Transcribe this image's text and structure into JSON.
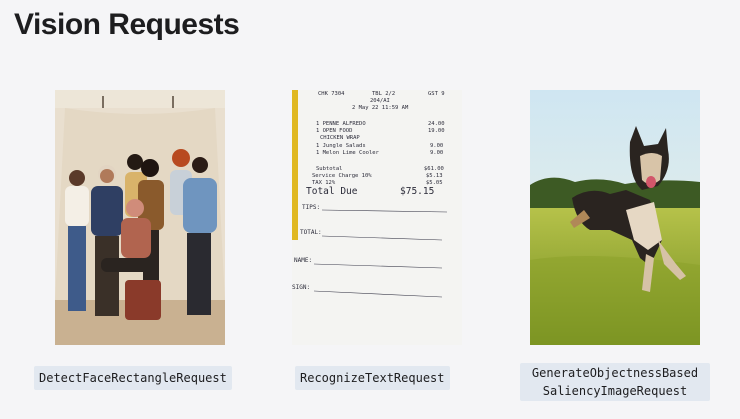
{
  "slide": {
    "title": "Vision Requests"
  },
  "cards": [
    {
      "label": "DetectFaceRectangleRequest"
    },
    {
      "label": "RecognizeTextRequest"
    },
    {
      "label_line1": "GenerateObjectnessBased",
      "label_line2": "SaliencyImageRequest"
    }
  ],
  "receipt": {
    "header1": "CHK 7304",
    "header2": "TBL 2/2",
    "header3": "GST 9",
    "header4": "204/AI",
    "date": "2 May 22 11:59 AM",
    "items": [
      {
        "name": "1 PENNE ALFREDO",
        "price": "24.00"
      },
      {
        "name": "1 OPEN FOOD",
        "price": "19.00"
      },
      {
        "name": "CHICKEN WRAP",
        "price": ""
      },
      {
        "name": "1 Jungle Salads",
        "price": "9.00"
      },
      {
        "name": "1 Melon Lime Cooler",
        "price": "9.00"
      }
    ],
    "subtotal_label": "Subtotal",
    "subtotal": "$61.00",
    "service_label": "Service Charge 10%",
    "service": "$5.13",
    "tax_label": "TAX 12%",
    "tax": "$5.05",
    "total_label": "Total Due",
    "total": "$75.15",
    "tips_label": "TIPS:",
    "total2_label": "TOTAL:",
    "name_label": "NAME:",
    "sign_label": "SIGN:"
  }
}
